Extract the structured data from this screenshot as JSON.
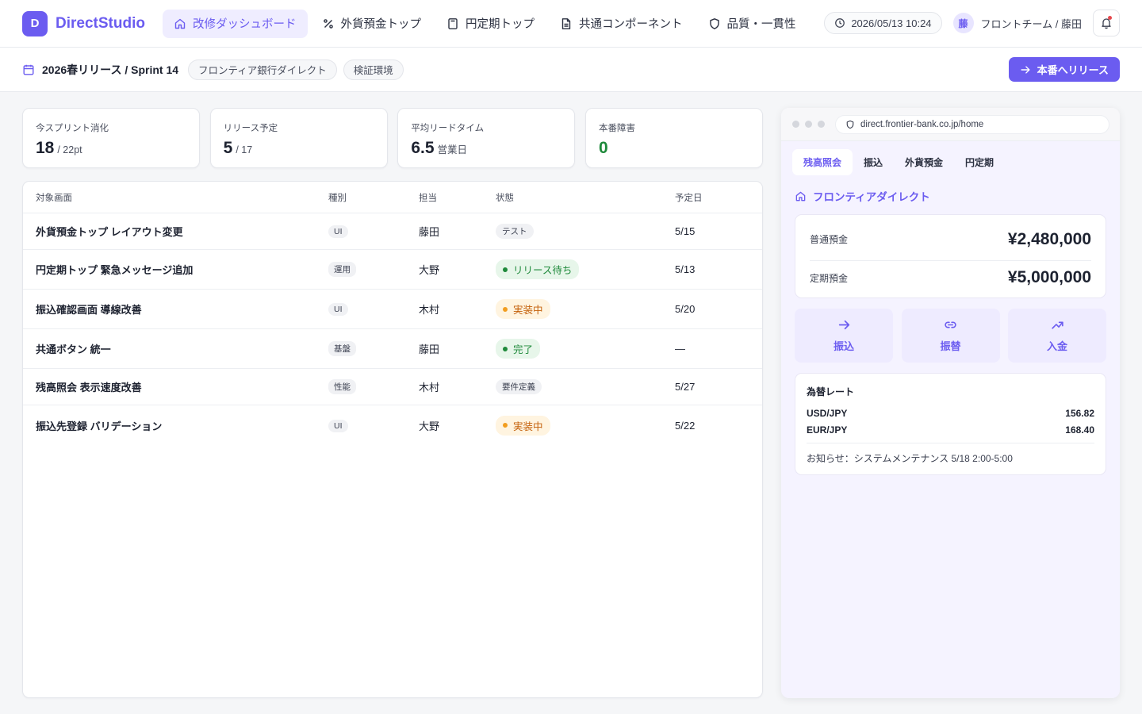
{
  "app": {
    "logo_letter": "D",
    "name": "DirectStudio"
  },
  "nav": [
    {
      "label": "改修ダッシュボード",
      "icon": "home-icon",
      "active": true
    },
    {
      "label": "外貨預金トップ",
      "icon": "percent-icon",
      "active": false
    },
    {
      "label": "円定期トップ",
      "icon": "calculator-icon",
      "active": false
    },
    {
      "label": "共通コンポーネント",
      "icon": "document-icon",
      "active": false
    },
    {
      "label": "品質・一貫性",
      "icon": "shield-icon",
      "active": false
    }
  ],
  "header": {
    "datetime": "2026/05/13 10:24",
    "user_initial": "藤",
    "user_label": "フロントチーム / 藤田"
  },
  "subheader": {
    "sprint": "2026春リリース / Sprint 14",
    "chips": [
      "フロンティア銀行ダイレクト",
      "検証環境"
    ],
    "release_button": "本番へリリース"
  },
  "stats": [
    {
      "label": "今スプリント消化",
      "value": "18",
      "unit": "/ 22pt"
    },
    {
      "label": "リリース予定",
      "value": "5",
      "unit": "/ 17"
    },
    {
      "label": "平均リードタイム",
      "value": "6.5",
      "unit": "営業日"
    },
    {
      "label": "本番障害",
      "value": "0",
      "unit": ""
    }
  ],
  "table": {
    "headers": [
      "対象画面",
      "種別",
      "担当",
      "状態",
      "予定日"
    ],
    "rows": [
      {
        "screen": "外貨預金トップ レイアウト変更",
        "type": "UI",
        "owner": "藤田",
        "status": "テスト",
        "date": "5/15"
      },
      {
        "screen": "円定期トップ 緊急メッセージ追加",
        "type": "運用",
        "owner": "大野",
        "status": "リリース待ち",
        "date": "5/13"
      },
      {
        "screen": "振込確認画面 導線改善",
        "type": "UI",
        "owner": "木村",
        "status": "実装中",
        "date": "5/20"
      },
      {
        "screen": "共通ボタン 統一",
        "type": "基盤",
        "owner": "藤田",
        "status": "完了",
        "date": "—"
      },
      {
        "screen": "残高照会 表示速度改善",
        "type": "性能",
        "owner": "木村",
        "status": "要件定義",
        "date": "5/27"
      },
      {
        "screen": "振込先登録 バリデーション",
        "type": "UI",
        "owner": "大野",
        "status": "実装中",
        "date": "5/22"
      }
    ]
  },
  "preview": {
    "url": "direct.frontier-bank.co.jp/home",
    "tabs": [
      "残高照会",
      "振込",
      "外貨預金",
      "円定期"
    ],
    "bank_name": "フロンティアダイレクト",
    "balances": [
      {
        "label": "普通預金",
        "amount": "¥2,480,000"
      },
      {
        "label": "定期預金",
        "amount": "¥5,000,000"
      }
    ],
    "actions": [
      {
        "label": "振込",
        "icon": "arrow-right-icon"
      },
      {
        "label": "振替",
        "icon": "link-icon"
      },
      {
        "label": "入金",
        "icon": "trend-up-icon"
      }
    ],
    "rates_title": "為替レート",
    "rates": [
      {
        "pair": "USD/JPY",
        "rate": "156.82"
      },
      {
        "pair": "EUR/JPY",
        "rate": "168.40"
      }
    ],
    "notice": "お知らせ：システムメンテナンス 5/18 2:00-5:00"
  },
  "colors": {
    "accent": "#6b5cf0",
    "success": "#1f8a3b",
    "warning": "#f29d1f"
  }
}
